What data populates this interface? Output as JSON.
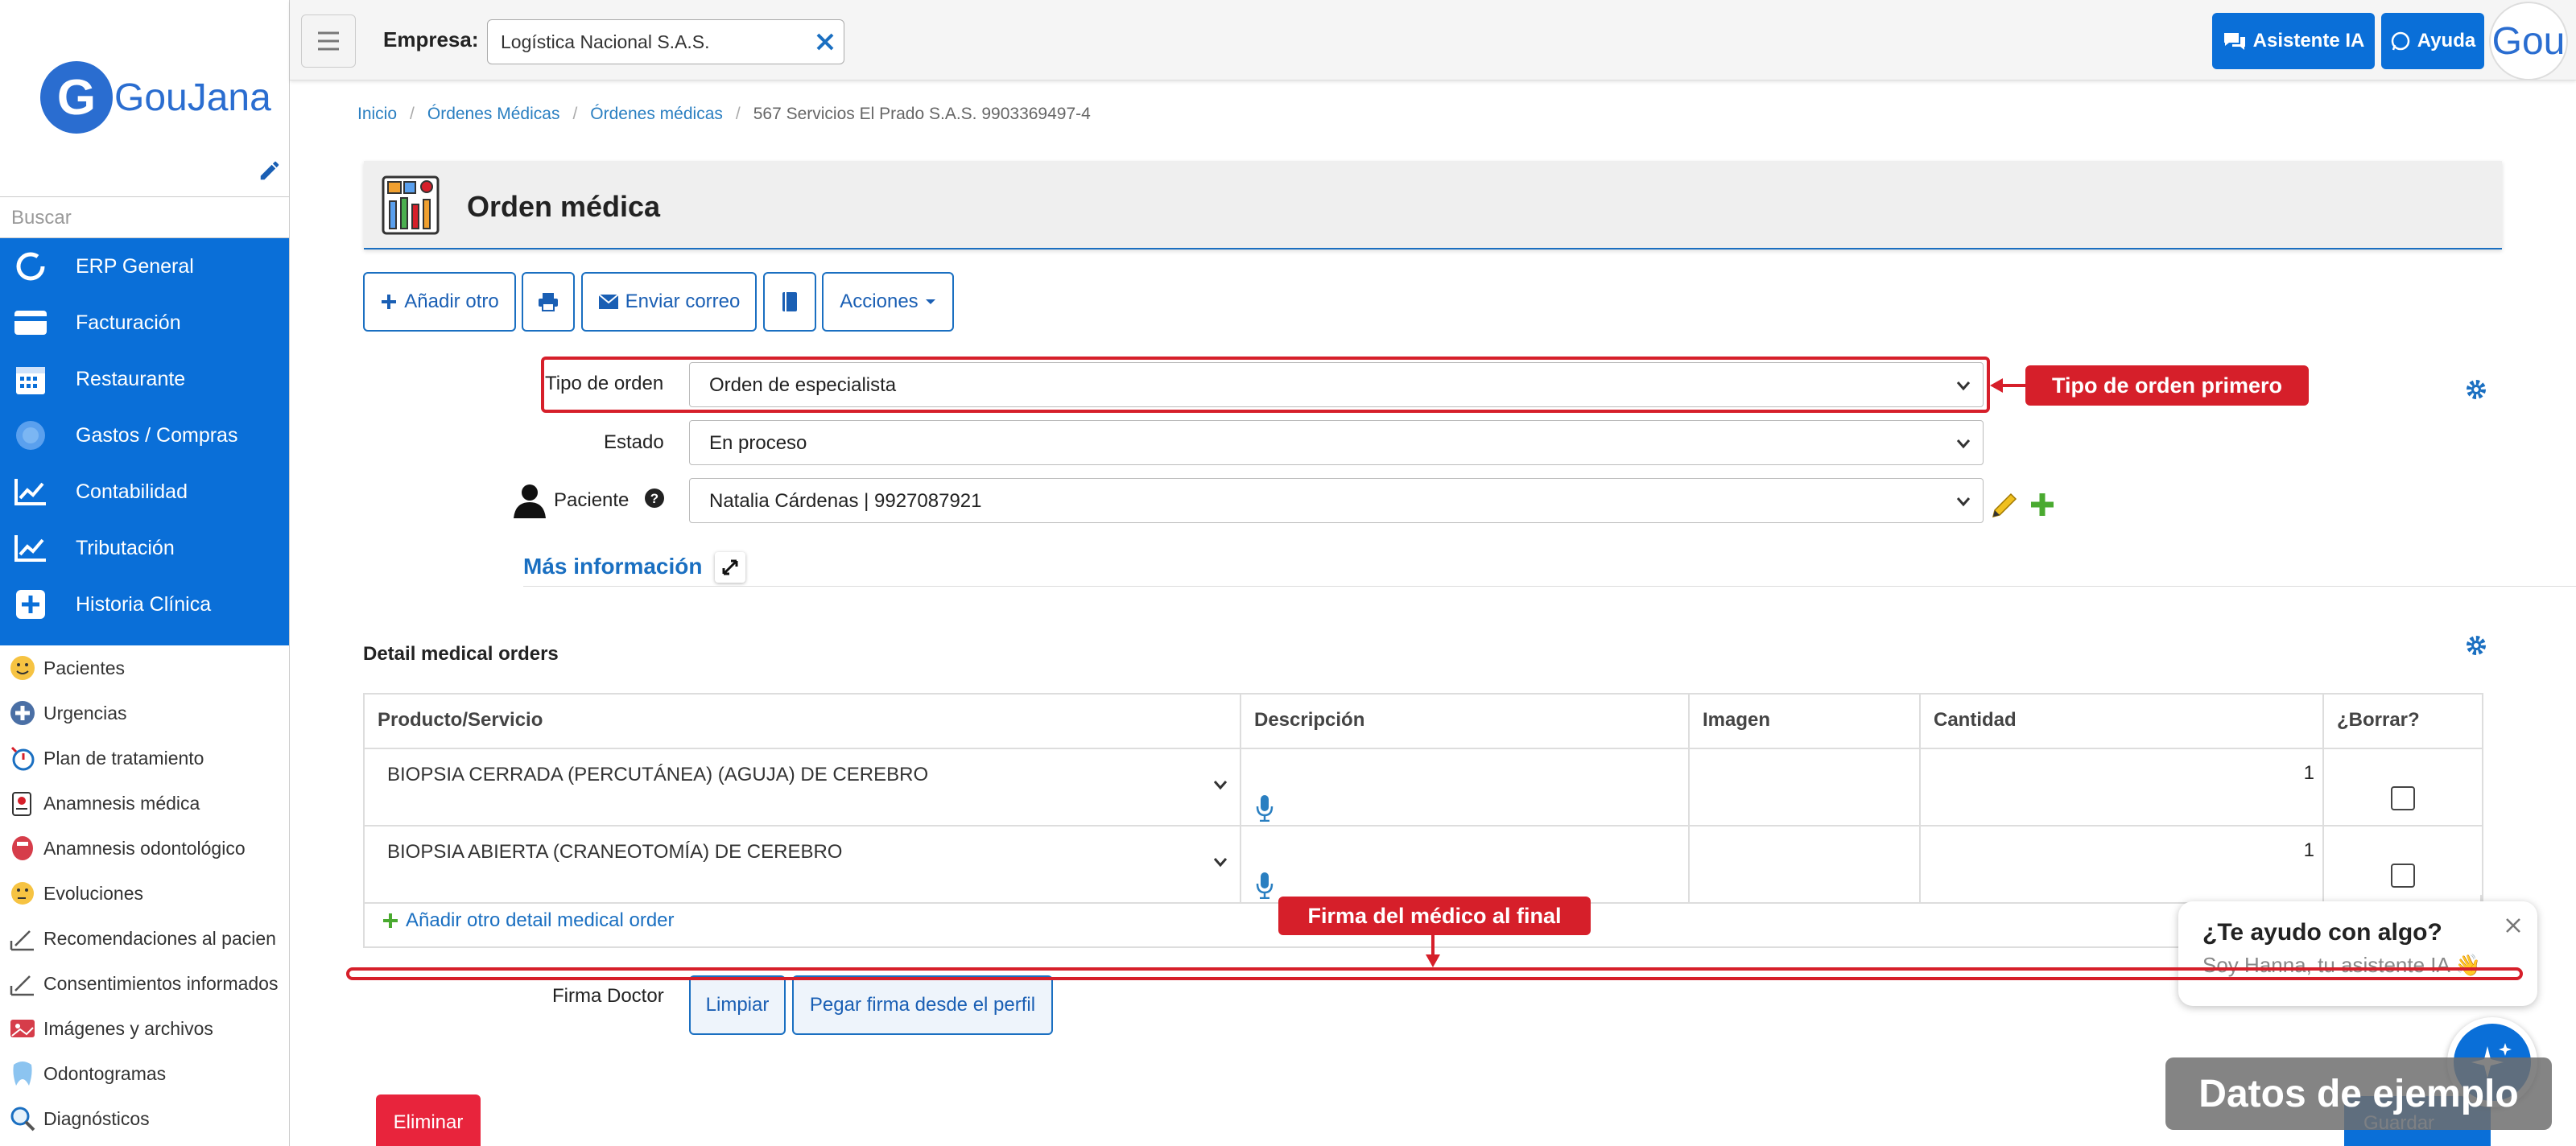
{
  "sidebar": {
    "logo_letter": "G",
    "logo_text": "GouJana",
    "search_placeholder": "Buscar",
    "modules": [
      {
        "label": "ERP General",
        "icon": "circle-icon"
      },
      {
        "label": "Facturación",
        "icon": "card-icon"
      },
      {
        "label": "Restaurante",
        "icon": "calendar-icon"
      },
      {
        "label": "Gastos / Compras",
        "icon": "blur-icon"
      },
      {
        "label": "Contabilidad",
        "icon": "chart-icon"
      },
      {
        "label": "Tributación",
        "icon": "chart-icon"
      },
      {
        "label": "Historia Clínica",
        "icon": "plus-square-icon"
      }
    ],
    "submodules": [
      {
        "label": "Pacientes",
        "icon": "face-icon"
      },
      {
        "label": "Urgencias",
        "icon": "ambulance-icon"
      },
      {
        "label": "Plan de tratamiento",
        "icon": "stopwatch-icon"
      },
      {
        "label": "Anamnesis médica",
        "icon": "clipboard-icon"
      },
      {
        "label": "Anamnesis odontológico",
        "icon": "mouth-icon"
      },
      {
        "label": "Evoluciones",
        "icon": "thinking-face-icon"
      },
      {
        "label": "Recomendaciones al pacien",
        "icon": "pen-sign-icon"
      },
      {
        "label": "Consentimientos informados",
        "icon": "pen-sign-icon"
      },
      {
        "label": "Imágenes y archivos",
        "icon": "images-icon"
      },
      {
        "label": "Odontogramas",
        "icon": "tooth-icon"
      },
      {
        "label": "Diagnósticos",
        "icon": "magnifier-icon"
      }
    ]
  },
  "topbar": {
    "empresa_label": "Empresa:",
    "empresa_value": "Logística Nacional S.A.S.",
    "asistente_label": "Asistente IA",
    "ayuda_label": "Ayuda",
    "avatar_text": "Gou"
  },
  "breadcrumb": {
    "items": [
      "Inicio",
      "Órdenes Médicas",
      "Órdenes médicas"
    ],
    "current": "567 Servicios El Prado S.A.S. 9903369497-4"
  },
  "page": {
    "title": "Orden médica"
  },
  "actions": {
    "add_label": "Añadir otro",
    "email_label": "Enviar correo",
    "more_label": "Acciones"
  },
  "form": {
    "tipo_label": "Tipo de orden",
    "tipo_value": "Orden de especialista",
    "estado_label": "Estado",
    "estado_value": "En proceso",
    "paciente_label": "Paciente",
    "paciente_value": "Natalia Cárdenas | 9927087921",
    "mas_info": "Más información"
  },
  "annotations": {
    "tipo": "Tipo de orden primero",
    "firma": "Firma del médico al final"
  },
  "detail": {
    "title": "Detail medical orders",
    "columns": [
      "Producto/Servicio",
      "Descripción",
      "Imagen",
      "Cantidad",
      "¿Borrar?"
    ],
    "rows": [
      {
        "product": "BIOPSIA CERRADA (PERCUTÁNEA) (AGUJA) DE CEREBRO",
        "qty": "1"
      },
      {
        "product": "BIOPSIA ABIERTA (CRANEOTOMÍA) DE CEREBRO",
        "qty": "1"
      }
    ],
    "add_label": "Añadir otro detail medical order"
  },
  "firma": {
    "label": "Firma Doctor",
    "clear_label": "Limpiar",
    "paste_label": "Pegar firma desde el perfil"
  },
  "footer": {
    "delete_label": "Eliminar",
    "save_label": "Guardar"
  },
  "chat": {
    "title": "¿Te ayudo con algo?",
    "subtitle": "Soy Hanna, tu asistente IA 👋"
  },
  "watermark": "Datos de ejemplo",
  "colors": {
    "primary": "#0a6fd8",
    "annotation": "#d61f2a",
    "danger": "#e8243c"
  }
}
